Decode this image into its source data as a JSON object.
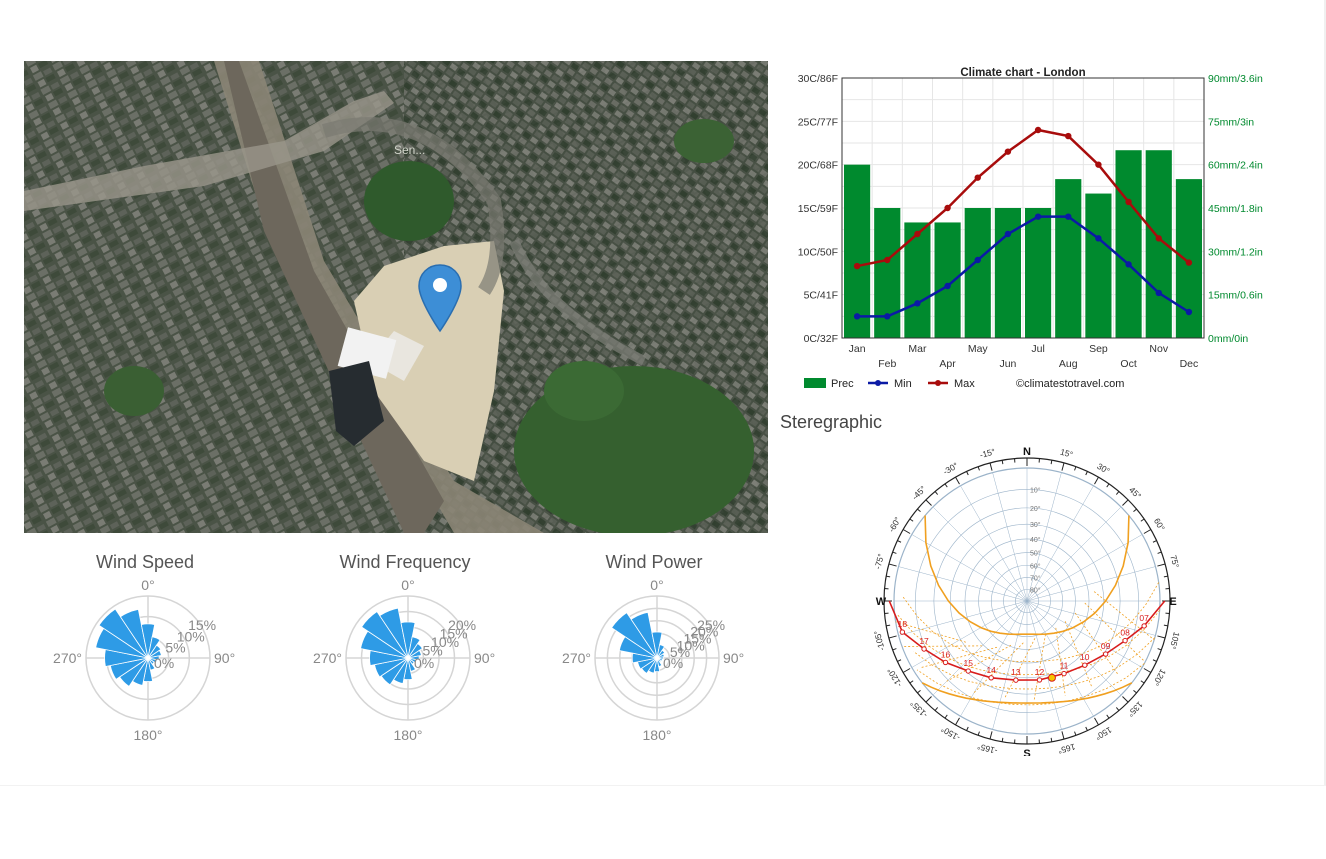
{
  "map": {
    "label": "Sen..."
  },
  "wind": [
    {
      "title": "Wind Speed",
      "rings": [
        "0%",
        "5%",
        "10%",
        "15%"
      ],
      "petals": [
        0.38,
        0.45,
        0.55,
        0.62,
        0.7,
        0.86,
        0.95,
        0.8,
        0.55,
        0.35,
        0.25,
        0.22,
        0.18,
        0.15,
        0.12,
        0.2
      ]
    },
    {
      "title": "Wind Frequency",
      "rings": [
        "0%",
        "5%",
        "10%",
        "15%",
        "20%"
      ],
      "petals": [
        0.35,
        0.42,
        0.52,
        0.55,
        0.62,
        0.78,
        0.9,
        0.82,
        0.58,
        0.35,
        0.28,
        0.22,
        0.18,
        0.14,
        0.12,
        0.22
      ]
    },
    {
      "title": "Wind Power",
      "rings": [
        "0%",
        "5%",
        "10%",
        "15%",
        "20%",
        "25%"
      ],
      "petals": [
        0.22,
        0.25,
        0.3,
        0.32,
        0.4,
        0.62,
        0.88,
        0.75,
        0.42,
        0.22,
        0.15,
        0.12,
        0.1,
        0.09,
        0.08,
        0.14
      ]
    }
  ],
  "wind_axis": {
    "n": "0°",
    "e": "90°",
    "s": "180°",
    "w": "270°"
  },
  "chart_data": {
    "type": "bar",
    "title": "Climate chart - London",
    "categories": [
      "Jan",
      "Feb",
      "Mar",
      "Apr",
      "May",
      "Jun",
      "Jul",
      "Aug",
      "Sep",
      "Oct",
      "Nov",
      "Dec"
    ],
    "precip_mm": [
      60,
      45,
      40,
      40,
      45,
      45,
      45,
      55,
      50,
      65,
      65,
      55
    ],
    "series": [
      {
        "name": "Min",
        "values": [
          2.5,
          2.5,
          4,
          6,
          9,
          12,
          14,
          14,
          11.5,
          8.5,
          5.2,
          3
        ]
      },
      {
        "name": "Max",
        "values": [
          8.3,
          9,
          12,
          15,
          18.5,
          21.5,
          24,
          23.3,
          20,
          15.7,
          11.5,
          8.7
        ]
      }
    ],
    "prec_name": "Prec",
    "left_ticks": [
      "0C/32F",
      "5C/41F",
      "10C/50F",
      "15C/59F",
      "20C/68F",
      "25C/77F",
      "30C/86F"
    ],
    "right_ticks": [
      "0mm/0in",
      "15mm/0.6in",
      "30mm/1.2in",
      "45mm/1.8in",
      "60mm/2.4in",
      "75mm/3in",
      "90mm/3.6in"
    ],
    "ylim_temp": [
      0,
      30
    ],
    "ylim_prec": [
      0,
      90
    ],
    "legend": "bottom",
    "credit": "©climatestotravel.com",
    "colors": {
      "prec": "#008a2e",
      "min": "#0b1aa5",
      "max": "#a80c0c"
    }
  },
  "stereo": {
    "label": "Steregraphic",
    "cardinals": {
      "n": "N",
      "e": "E",
      "s": "S",
      "w": "W"
    },
    "azimuth_labels": [
      {
        "deg": 15,
        "t": "15°"
      },
      {
        "deg": 30,
        "t": "30°"
      },
      {
        "deg": 45,
        "t": "45°"
      },
      {
        "deg": 60,
        "t": "60°"
      },
      {
        "deg": 75,
        "t": "75°"
      },
      {
        "deg": 105,
        "t": "105°"
      },
      {
        "deg": 120,
        "t": "120°"
      },
      {
        "deg": 135,
        "t": "135°"
      },
      {
        "deg": 150,
        "t": "150°"
      },
      {
        "deg": 165,
        "t": "165°"
      },
      {
        "deg": 195,
        "t": "-165°"
      },
      {
        "deg": 210,
        "t": "-150°"
      },
      {
        "deg": 225,
        "t": "-135°"
      },
      {
        "deg": 240,
        "t": "-120°"
      },
      {
        "deg": 255,
        "t": "-105°"
      },
      {
        "deg": 285,
        "t": "-75°"
      },
      {
        "deg": 300,
        "t": "-60°"
      },
      {
        "deg": 315,
        "t": "-45°"
      },
      {
        "deg": 330,
        "t": "-30°"
      },
      {
        "deg": 345,
        "t": "-15°"
      }
    ],
    "altitude_labels": [
      "10°",
      "20°",
      "30°",
      "40°",
      "50°",
      "60°",
      "70°",
      "80°"
    ],
    "hours": [
      {
        "t": "07",
        "az": 102,
        "alt": 6
      },
      {
        "t": "08",
        "az": 112,
        "alt": 13
      },
      {
        "t": "09",
        "az": 124,
        "alt": 19
      },
      {
        "t": "10",
        "az": 138,
        "alt": 24
      },
      {
        "t": "11",
        "az": 153,
        "alt": 27
      },
      {
        "t": "12",
        "az": 171,
        "alt": 28
      },
      {
        "t": "13",
        "az": 188,
        "alt": 28
      },
      {
        "t": "14",
        "az": 205,
        "alt": 25
      },
      {
        "t": "15",
        "az": 220,
        "alt": 21
      },
      {
        "t": "16",
        "az": 233,
        "alt": 15
      },
      {
        "t": "17",
        "az": 245,
        "alt": 9
      },
      {
        "t": "18",
        "az": 256,
        "alt": 2
      }
    ],
    "colors": {
      "path": "#d81c1c",
      "season": "#f0a020",
      "grid": "#9bb3c9"
    }
  }
}
